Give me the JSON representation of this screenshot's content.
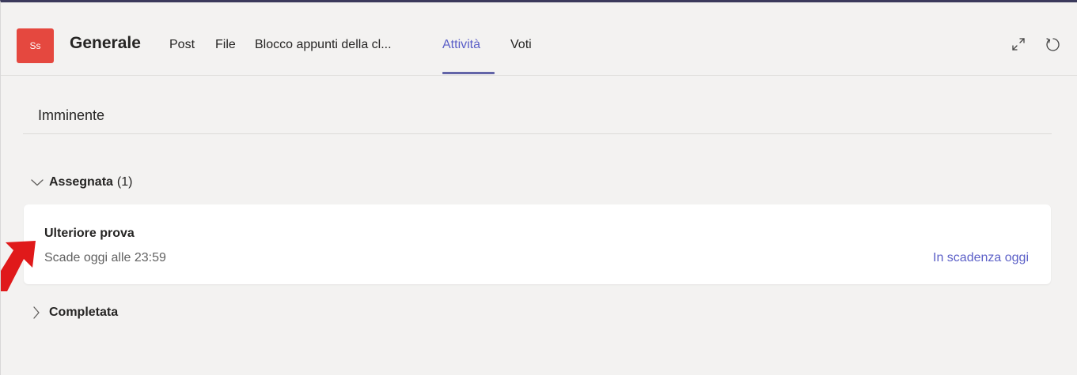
{
  "header": {
    "avatar_initials": "Ss",
    "avatar_color": "#e5483f",
    "channel_name": "Generale",
    "tabs": [
      {
        "label": "Post",
        "active": false
      },
      {
        "label": "File",
        "active": false
      },
      {
        "label": "Blocco appunti della cl...",
        "active": false
      },
      {
        "label": "Attività",
        "active": true
      },
      {
        "label": "Voti",
        "active": false
      }
    ],
    "icons": [
      "expand-icon",
      "refresh-icon"
    ],
    "accent_color": "#5b5fc7"
  },
  "main": {
    "section_title": "Imminente",
    "groups": [
      {
        "label": "Assegnata",
        "count": "(1)",
        "expanded": true,
        "items": [
          {
            "title": "Ulteriore prova",
            "due": "Scade oggi alle 23:59",
            "status": "In scadenza oggi"
          }
        ]
      },
      {
        "label": "Completata",
        "expanded": false
      }
    ]
  },
  "annotation": {
    "arrow_color": "#e0191a",
    "icon": "red-arrow-icon"
  }
}
